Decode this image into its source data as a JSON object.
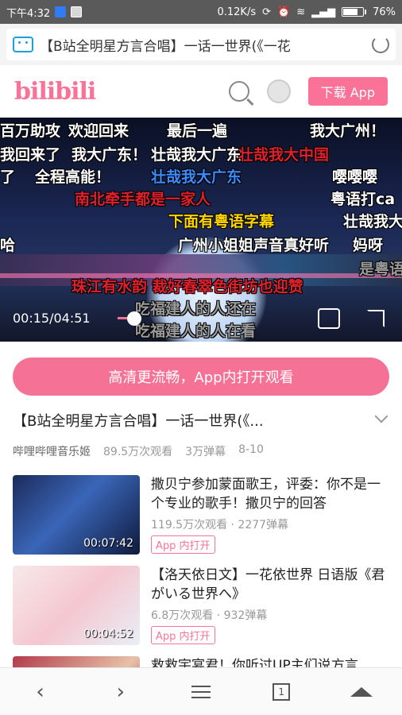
{
  "status_bar": {
    "time": "下午4:32",
    "net_speed": "0.12K/s",
    "battery": "76%",
    "battery_level": 0.76
  },
  "url_bar": {
    "title": "【B站全明星方言合唱】一话一世界(《一花"
  },
  "header": {
    "logo": "bilibili",
    "download_label": "下载 App"
  },
  "player": {
    "time_label": "00:15/04:51",
    "progress": 0.05,
    "danmaku": [
      {
        "text": "百万助攻",
        "color": "w"
      },
      {
        "text": "欢迎回来",
        "color": "w"
      },
      {
        "text": "最后一遍",
        "color": "w"
      },
      {
        "text": "我大广州！",
        "color": "w"
      },
      {
        "text": "我回来了",
        "color": "w"
      },
      {
        "text": "我大广东！",
        "color": "w"
      },
      {
        "text": "壮哉我大广东",
        "color": "w"
      },
      {
        "text": "壮哉我大中国",
        "color": "r"
      },
      {
        "text": "了",
        "color": "w"
      },
      {
        "text": "全程高能！",
        "color": "w"
      },
      {
        "text": "壮哉我大广东",
        "color": "b"
      },
      {
        "text": "嘤嘤嘤",
        "color": "w"
      },
      {
        "text": "南北牵手都是一家人",
        "color": "r"
      },
      {
        "text": "粤语打ca",
        "color": "w"
      },
      {
        "text": "下面有粤语字幕",
        "color": "y"
      },
      {
        "text": "壮哉我大",
        "color": "w"
      },
      {
        "text": "哈",
        "color": "w"
      },
      {
        "text": "广州小姐姐声音真好听",
        "color": "w"
      },
      {
        "text": "妈呀",
        "color": "w"
      },
      {
        "text": "是粤语",
        "color": "g"
      },
      {
        "text": "珠江有水韵 裁好春翠色街坊也迎赞",
        "color": "r"
      },
      {
        "text": "吃福建人的人还在",
        "color": "g"
      },
      {
        "text": "吃福建人的人在看",
        "color": "g"
      }
    ]
  },
  "open_app_label": "高清更流畅，App内打开观看",
  "video": {
    "title": "【B站全明星方言合唱】一话一世界(《...",
    "uploader": "哔哩哔哩音乐姬",
    "views": "89.5万次观看",
    "danmaku_count": "3万弹幕",
    "date": "8-10"
  },
  "related": [
    {
      "title": "撒贝宁参加蒙面歌王，评委：你不是一个专业的歌手！撒贝宁的回答",
      "stats": "119.5万次观看 · 2277弹幕",
      "duration": "00:07:42",
      "app_label": "App 内打开"
    },
    {
      "title": "【洛天依日文】一花依世界 日语版《君がいる世界へ》",
      "stats": "6.8万次观看 · 932弹幕",
      "duration": "00:04:52",
      "app_label": "App 内打开"
    },
    {
      "title": "救救宇宴君！你听过UP主们说方言",
      "stats": "",
      "duration": "",
      "app_label": ""
    }
  ],
  "nav": {
    "tab_count": "1"
  }
}
